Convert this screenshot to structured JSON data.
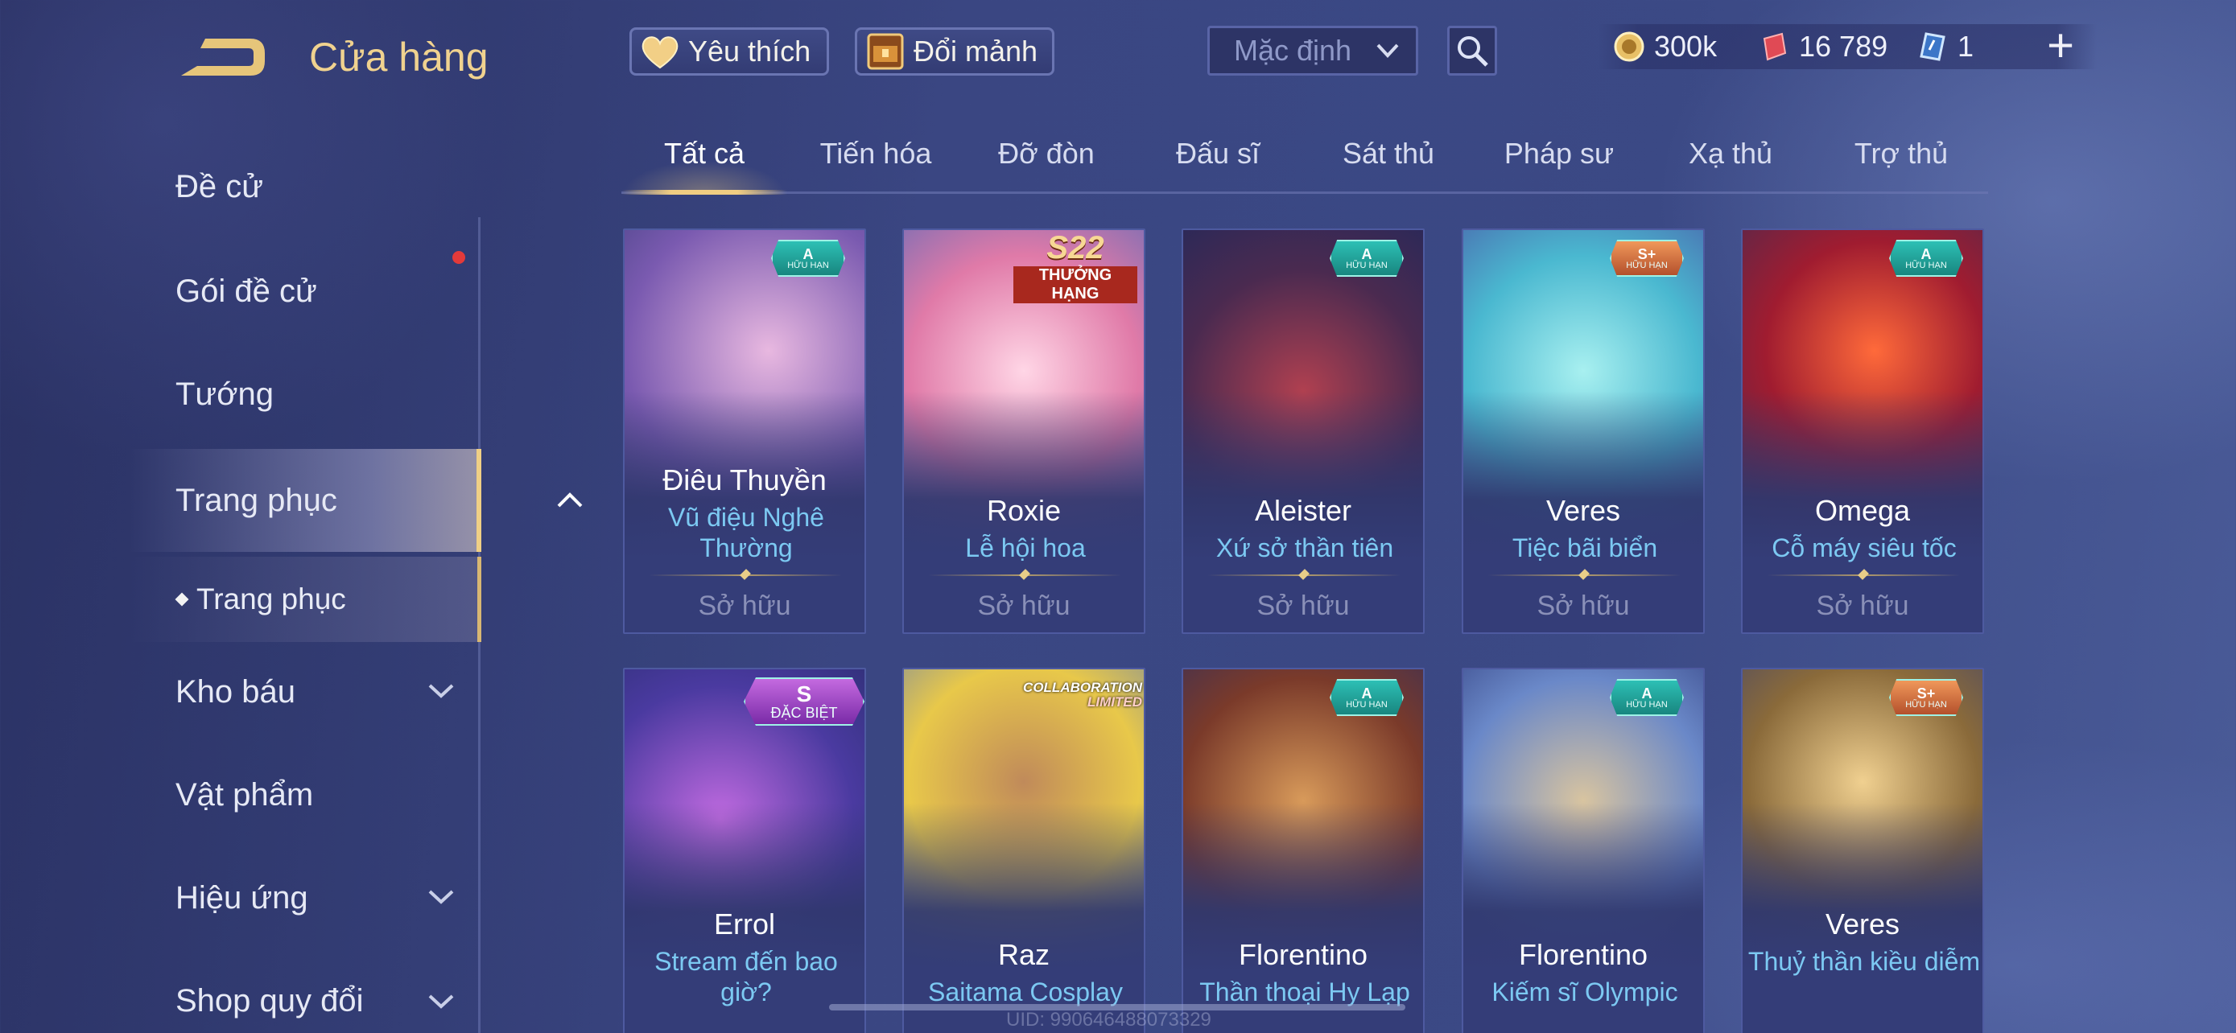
{
  "header": {
    "title": "Cửa hàng",
    "favorite_label": "Yêu thích",
    "shard_exchange_label": "Đổi mảnh",
    "sort_value": "Mặc định",
    "currencies": [
      {
        "icon": "gold-coin-icon",
        "value": "300k"
      },
      {
        "icon": "red-voucher-icon",
        "value": "16 789"
      },
      {
        "icon": "blue-card-icon",
        "value": "1"
      }
    ],
    "add_label": "+"
  },
  "sidebar": {
    "items": [
      {
        "label": "Đề cử"
      },
      {
        "label": "Gói đề cử"
      },
      {
        "label": "Tướng"
      },
      {
        "label": "Trang phục"
      },
      {
        "label": "Kho báu"
      },
      {
        "label": "Vật phẩm"
      },
      {
        "label": "Hiệu ứng"
      },
      {
        "label": "Shop quy đổi"
      }
    ],
    "subitem": "Trang phục"
  },
  "tabs": [
    "Tất cả",
    "Tiến hóa",
    "Đỡ đòn",
    "Đấu sĩ",
    "Sát thủ",
    "Pháp sư",
    "Xạ thủ",
    "Trợ thủ"
  ],
  "cards": [
    {
      "hero": "Điêu Thuyền",
      "skin": "Vũ điệu Nghê Thường",
      "status": "Sở hữu",
      "badge_rank": "A",
      "badge_text": "HỮU HẠN"
    },
    {
      "hero": "Roxie",
      "skin": "Lễ hội hoa",
      "status": "Sở hữu",
      "badge_rank": "S22",
      "badge_text": "THƯỞNG HẠNG"
    },
    {
      "hero": "Aleister",
      "skin": "Xứ sở thần tiên",
      "status": "Sở hữu",
      "badge_rank": "A",
      "badge_text": "HỮU HẠN"
    },
    {
      "hero": "Veres",
      "skin": "Tiệc bãi biển",
      "status": "Sở hữu",
      "badge_rank": "S+",
      "badge_text": "HỮU HẠN"
    },
    {
      "hero": "Omega",
      "skin": "Cỗ máy siêu tốc",
      "status": "Sở hữu",
      "badge_rank": "A",
      "badge_text": "HỮU HẠN"
    },
    {
      "hero": "Errol",
      "skin": "Stream đến bao giờ?",
      "badge_rank": "S",
      "badge_text": "ĐẶC BIỆT"
    },
    {
      "hero": "Raz",
      "skin": "Saitama Cosplay",
      "badge_rank": "COLLABORATION",
      "badge_text": "LIMITED"
    },
    {
      "hero": "Florentino",
      "skin": "Thần thoại Hy Lạp",
      "badge_rank": "A",
      "badge_text": "HỮU HẠN"
    },
    {
      "hero": "Florentino",
      "skin": "Kiếm sĩ Olympic",
      "badge_rank": "A",
      "badge_text": "HỮU HẠN"
    },
    {
      "hero": "Veres",
      "skin": "Thuỷ thần kiều diễm",
      "badge_rank": "S+",
      "badge_text": "HỮU HẠN"
    }
  ],
  "footer": {
    "uid": "UID: 990646488073329"
  }
}
